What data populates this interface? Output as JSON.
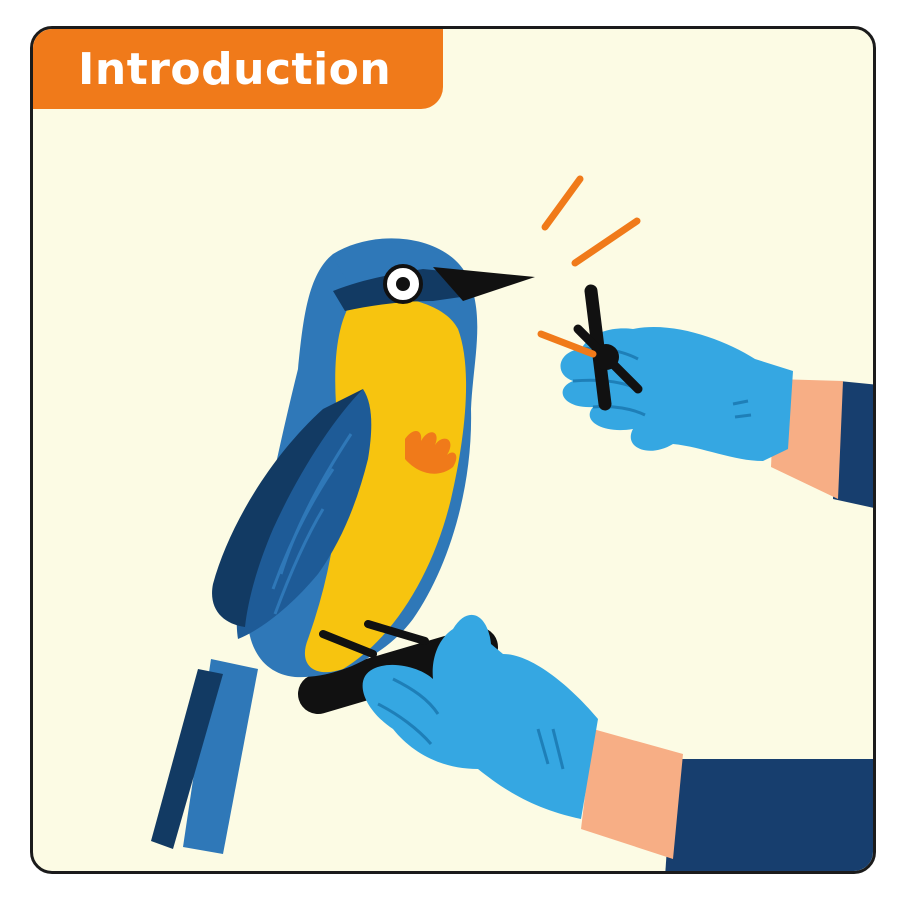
{
  "header": {
    "title": "Introduction"
  },
  "colors": {
    "accent": "#f07a1a",
    "background": "#fcfbe4",
    "outline": "#1b1b1b",
    "bird_blue": "#2f78b8",
    "bird_dark_blue": "#123a63",
    "bird_yellow": "#f7c40f",
    "glove_blue": "#35a7e2",
    "sleeve_navy": "#173e6e",
    "skin": "#f7ae85"
  },
  "illustration": {
    "subjects": [
      "bird",
      "gloved-hands",
      "leg-band"
    ]
  }
}
